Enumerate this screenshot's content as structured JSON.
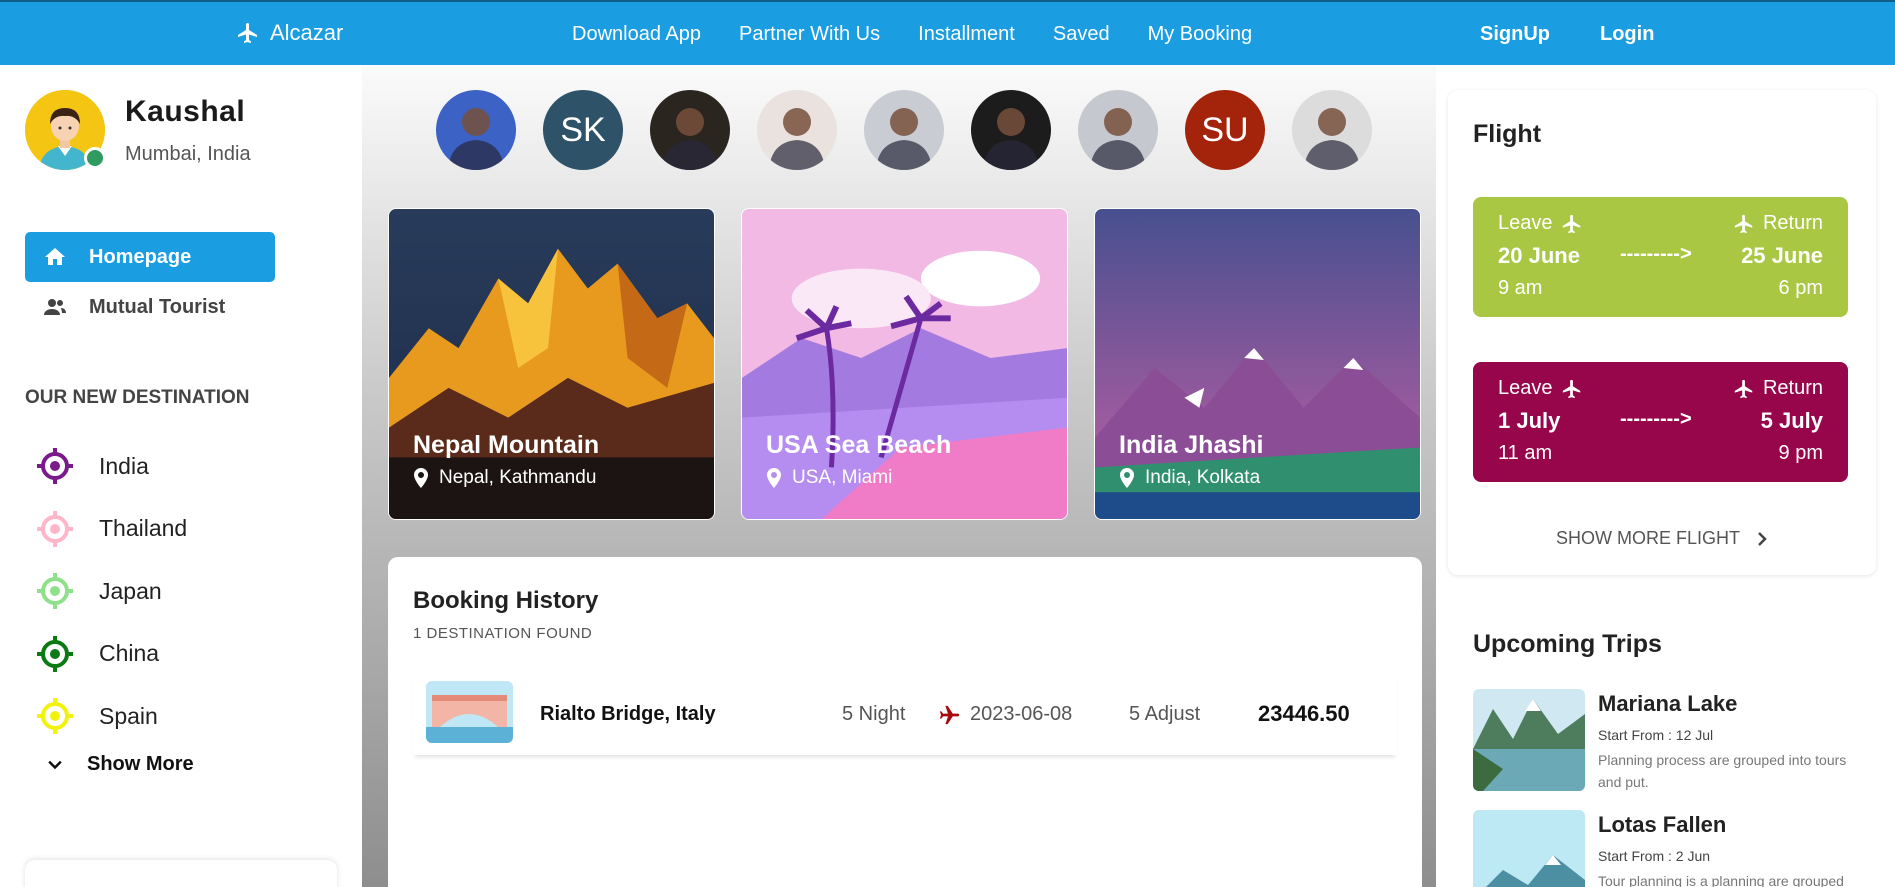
{
  "header": {
    "brand": "Alcazar",
    "nav": [
      "Download App",
      "Partner With Us",
      "Installment",
      "Saved",
      "My Booking"
    ],
    "signup": "SignUp",
    "login": "Login"
  },
  "profile": {
    "name": "Kaushal",
    "location": "Mumbai, India"
  },
  "menu": [
    {
      "label": "Homepage",
      "icon": "home-icon",
      "active": true
    },
    {
      "label": "Mutual Tourist",
      "icon": "users-icon",
      "active": false
    }
  ],
  "destinations": {
    "title": "OUR NEW DESTINATION",
    "items": [
      {
        "name": "India",
        "color": "#7b1a8a"
      },
      {
        "name": "Thailand",
        "color": "#ffb6c8"
      },
      {
        "name": "Japan",
        "color": "#8fe08a"
      },
      {
        "name": "China",
        "color": "#0b7a12"
      },
      {
        "name": "Spain",
        "color": "#f2f20f"
      }
    ],
    "show_more": "Show More"
  },
  "people": [
    {
      "initials": "",
      "color": "#3b62c4"
    },
    {
      "initials": "SK",
      "color": "#2e5268"
    },
    {
      "initials": "",
      "color": "#2b2520"
    },
    {
      "initials": "",
      "color": "#e9e2de"
    },
    {
      "initials": "",
      "color": "#c9ccd2"
    },
    {
      "initials": "",
      "color": "#1c1c1c"
    },
    {
      "initials": "",
      "color": "#c6c8cf"
    },
    {
      "initials": "SU",
      "color": "#a3240a"
    },
    {
      "initials": "",
      "color": "#dcdcdc"
    }
  ],
  "cards": [
    {
      "title": "Nepal Mountain",
      "location": "Nepal, Kathmandu"
    },
    {
      "title": "USA Sea Beach",
      "location": "USA, Miami"
    },
    {
      "title": "India Jhashi",
      "location": "India, Kolkata"
    }
  ],
  "booking": {
    "title": "Booking History",
    "subtitle": "1 DESTINATION FOUND",
    "rows": [
      {
        "name": "Rialto Bridge, Italy",
        "nights": "5 Night",
        "date": "2023-06-08",
        "adjust": "5 Adjust",
        "price": "23446.50"
      }
    ]
  },
  "flight": {
    "title": "Flight",
    "cards": [
      {
        "leave": "Leave",
        "return": "Return",
        "from_date": "20 June",
        "arrow": "--------->",
        "to_date": "25 June",
        "from_time": "9 am",
        "to_time": "6 pm",
        "color": "#a9c743"
      },
      {
        "leave": "Leave",
        "return": "Return",
        "from_date": "1 July",
        "arrow": "--------->",
        "to_date": "5 July",
        "from_time": "11 am",
        "to_time": "9 pm",
        "color": "#97064a"
      }
    ],
    "show_more": "SHOW MORE FLIGHT"
  },
  "trips": {
    "title": "Upcoming Trips",
    "items": [
      {
        "name": "Mariana Lake",
        "start": "Start From : 12 Jul",
        "desc": "Planning process are grouped into tours and put."
      },
      {
        "name": "Lotas Fallen",
        "start": "Start From : 2 Jun",
        "desc": "Tour planning is a planning are grouped"
      }
    ]
  }
}
